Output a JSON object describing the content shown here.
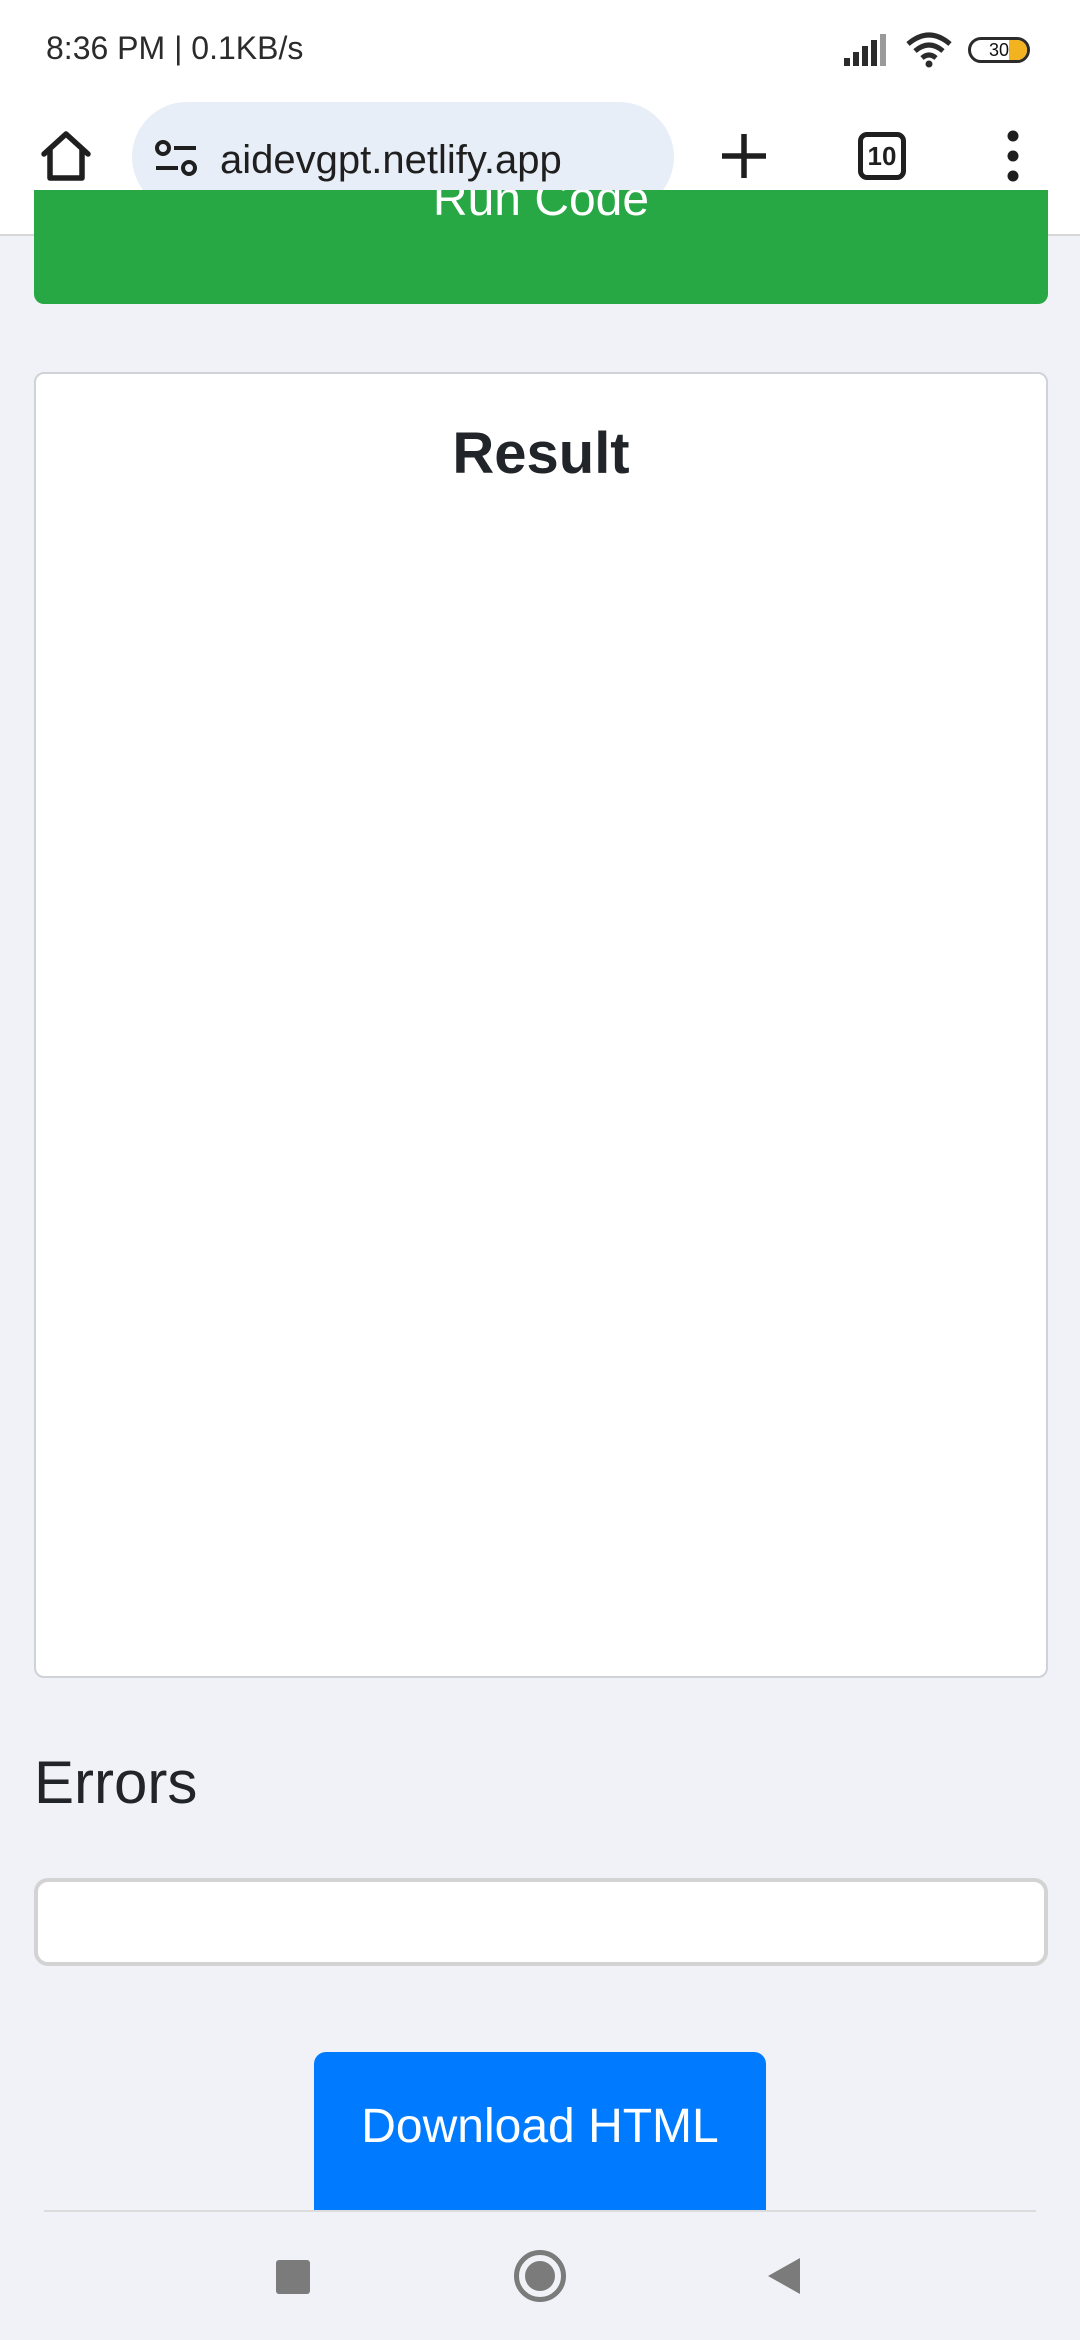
{
  "status_bar": {
    "time": "8:36 PM | 0.1KB/s",
    "battery": "30"
  },
  "browser": {
    "url": "aidevgpt.netlify.app",
    "tab_count": "10"
  },
  "page": {
    "run_button_label": "Run Code",
    "result_title": "Result",
    "errors_heading": "Errors",
    "errors_value": "",
    "download_button_label": "Download HTML"
  },
  "colors": {
    "run_button": "#28a745",
    "download_button": "#007bff",
    "page_background": "#f1f2f7"
  }
}
